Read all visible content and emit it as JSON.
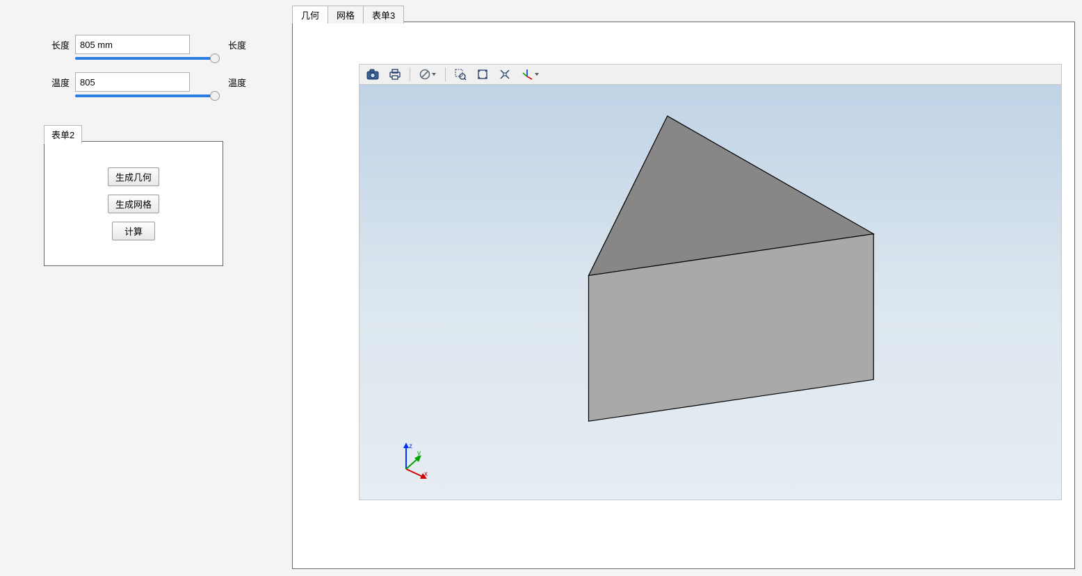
{
  "params": {
    "length": {
      "label_left": "长度",
      "value": "805 mm",
      "label_right": "长度"
    },
    "temperature": {
      "label_left": "温度",
      "value": "805",
      "label_right": "温度"
    }
  },
  "form2": {
    "tab_label": "表单2",
    "gen_geometry": "生成几何",
    "gen_mesh": "生成网格",
    "compute": "计算"
  },
  "main_tabs": {
    "geometry": "几何",
    "mesh": "网格",
    "form3": "表单3"
  },
  "triad": {
    "x": "x",
    "y": "y",
    "z": "z"
  }
}
